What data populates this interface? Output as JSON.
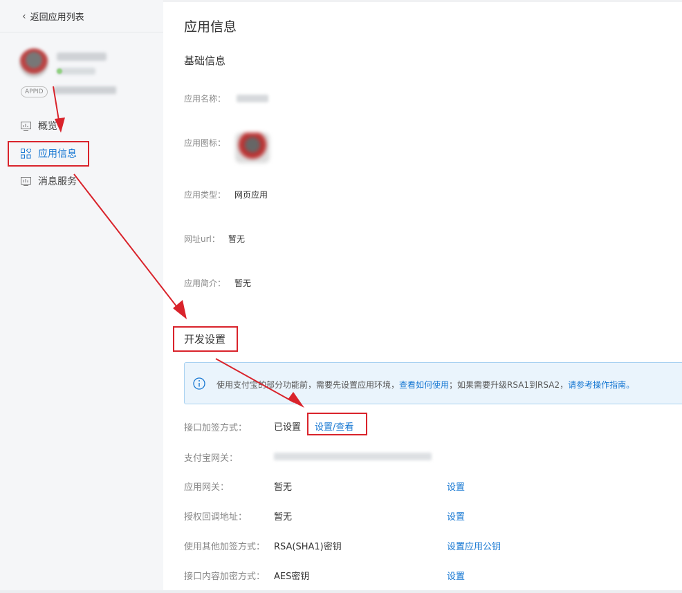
{
  "sidebar": {
    "back_label": "返回应用列表",
    "appid_badge": "APPID",
    "items": [
      {
        "label": "概览",
        "icon": "dashboard-icon"
      },
      {
        "label": "应用信息",
        "icon": "grid-apps-icon"
      },
      {
        "label": "消息服务",
        "icon": "monitor-icon"
      }
    ]
  },
  "main": {
    "title": "应用信息",
    "basic_section": "基础信息",
    "basic_fields": [
      {
        "label": "应用名称：",
        "value": ""
      },
      {
        "label": "应用图标：",
        "value": ""
      },
      {
        "label": "应用类型：",
        "value": "网页应用"
      },
      {
        "label": "网址url：",
        "value": "暂无"
      },
      {
        "label": "应用简介：",
        "value": "暂无"
      }
    ],
    "dev_section": "开发设置",
    "notice": {
      "text1": "使用支付宝的部分功能前，需要先设置应用环境，",
      "link1": "查看如何使用",
      "text2": "；如果需要升级RSA1到RSA2，",
      "link2": "请参考操作指南。"
    },
    "dev_fields": [
      {
        "label": "接口加签方式：",
        "value": "已设置",
        "action": "设置/查看"
      },
      {
        "label": "支付宝网关：",
        "value": "",
        "action": ""
      },
      {
        "label": "应用网关：",
        "value": "暂无",
        "action": "设置"
      },
      {
        "label": "授权回调地址：",
        "value": "暂无",
        "action": "设置"
      },
      {
        "label": "使用其他加签方式：",
        "value": "RSA(SHA1)密钥",
        "action": "设置应用公钥"
      },
      {
        "label": "接口内容加密方式：",
        "value": "AES密钥",
        "action": "设置"
      }
    ]
  },
  "colors": {
    "accent": "#1677d2",
    "annotation_red": "#d9232b",
    "sidebar_bg": "#f5f6f8",
    "notice_bg": "#eaf4fc"
  }
}
